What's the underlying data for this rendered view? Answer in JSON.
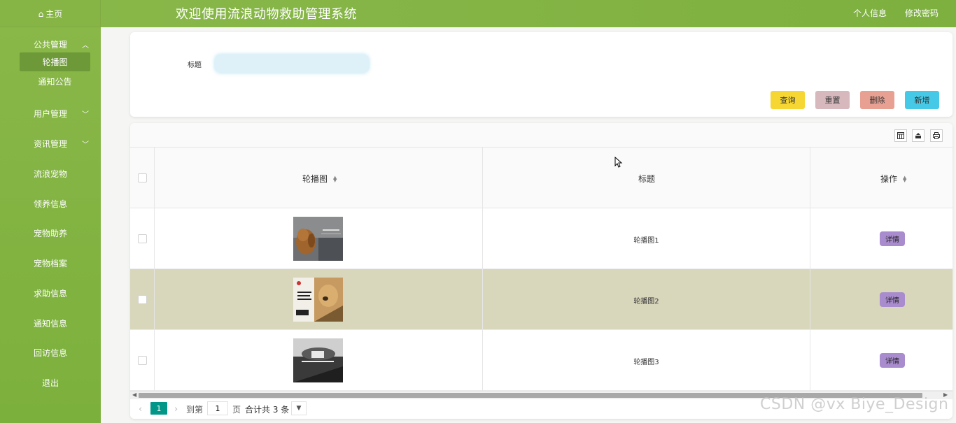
{
  "header": {
    "home_tab": "主页",
    "app_title": "欢迎使用流浪动物救助管理系统",
    "links": [
      "个人信息",
      "修改密码"
    ]
  },
  "sidebar": {
    "groups": [
      {
        "label": "公共管理",
        "expanded": true,
        "children": [
          "轮播图",
          "通知公告"
        ],
        "active_child": "轮播图"
      },
      {
        "label": "用户管理",
        "expandable": true
      },
      {
        "label": "资讯管理",
        "expandable": true
      },
      {
        "label": "流浪宠物"
      },
      {
        "label": "领养信息"
      },
      {
        "label": "宠物助养"
      },
      {
        "label": "宠物档案"
      },
      {
        "label": "求助信息"
      },
      {
        "label": "通知信息"
      },
      {
        "label": "回访信息"
      },
      {
        "label": "退出"
      }
    ]
  },
  "search": {
    "label": "标题",
    "value": "",
    "buttons": {
      "query": "查询",
      "reset": "重置",
      "delete": "删除",
      "add": "新增"
    },
    "colors": {
      "query": "#f5d632",
      "reset": "#d6b8bd",
      "delete": "#e8a092",
      "add": "#45c9e6"
    }
  },
  "table": {
    "columns": [
      "轮播图",
      "标题",
      "操作"
    ],
    "rows": [
      {
        "title": "轮播图1",
        "action": "详情",
        "highlighted": false
      },
      {
        "title": "轮播图2",
        "action": "详情",
        "highlighted": true
      },
      {
        "title": "轮播图3",
        "action": "详情",
        "highlighted": false
      }
    ]
  },
  "pagination": {
    "current_page": "1",
    "goto_prefix": "到第",
    "goto_value": "1",
    "goto_suffix": "页",
    "total_text": "合计共 3 条"
  },
  "watermark": "CSDN @vx Biye_Design",
  "theme": {
    "accent": "#80b342",
    "detail_button": "#a98ccd",
    "highlight_row": "#d8d6bb"
  }
}
